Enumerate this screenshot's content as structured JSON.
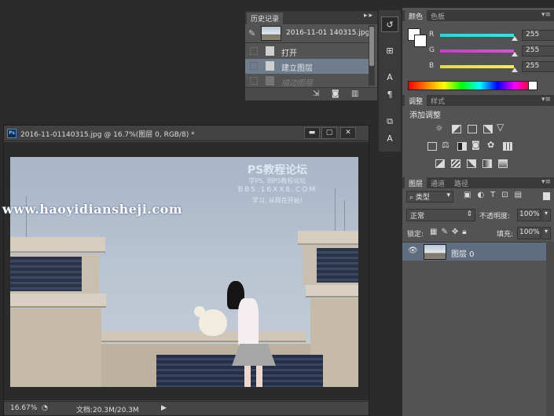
{
  "history_panel": {
    "tab_label": "历史记录",
    "collapse_label": "▸▸",
    "menu_label": "≡",
    "snapshot_name": "2016-11-01 140315.jpg",
    "steps": [
      {
        "label": "打开",
        "state": "normal"
      },
      {
        "label": "建立图层",
        "state": "selected"
      },
      {
        "label": "描边图层",
        "state": "dimmed"
      }
    ]
  },
  "color_panel": {
    "tabs": [
      "颜色",
      "色板"
    ],
    "channels": [
      {
        "name": "R",
        "value": "255",
        "color": "#2dd4e0"
      },
      {
        "name": "G",
        "value": "255",
        "color": "#d43bd4"
      },
      {
        "name": "B",
        "value": "255",
        "color": "#e8e834"
      }
    ]
  },
  "adjust_panel": {
    "tabs": [
      "调整",
      "样式"
    ],
    "heading": "添加调整"
  },
  "layers_panel": {
    "tabs": [
      "图层",
      "通道",
      "路径"
    ],
    "filter_label": "类型",
    "blend_mode": "正常",
    "opacity_label": "不透明度:",
    "opacity_value": "100%",
    "lock_label": "锁定:",
    "fill_label": "填充:",
    "fill_value": "100%",
    "layers": [
      {
        "name": "图层 0",
        "visible": true
      }
    ]
  },
  "document": {
    "title": "2016-11-01140315.jpg @ 16.7%(图层 0, RGB/8) *",
    "ps_badge": "Ps",
    "min_label": "▬",
    "max_label": "▢",
    "close_label": "✕",
    "zoom": "16.67%",
    "doc_info": "文档:20.3M/20.3M",
    "watermark_title": "PS教程论坛",
    "watermark_sub1": "学PS, 到PS教程论坛",
    "watermark_sub2": "BBS.16XX8.COM",
    "watermark_sub3": "学习, 从现在开始!",
    "url_watermark": "www.haoyidiansheji.com"
  }
}
